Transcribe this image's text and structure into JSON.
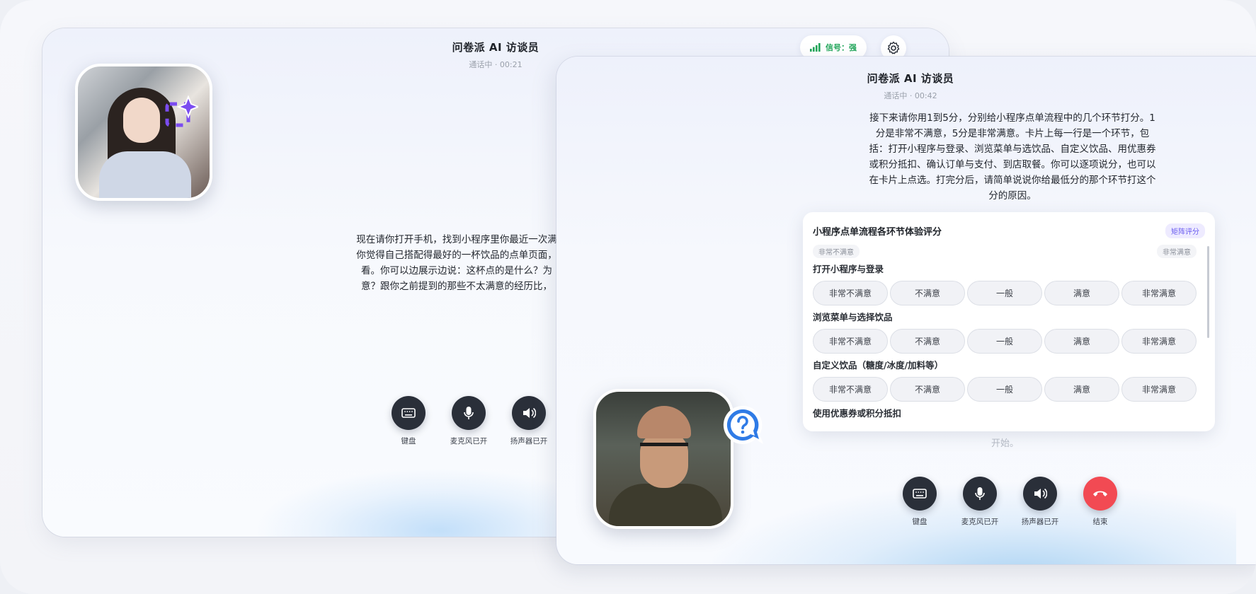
{
  "back_window": {
    "title": "问卷派 AI 访谈员",
    "subtitle": "通话中 · 00:21",
    "signal_label": "信号：强",
    "speech_lines": [
      "现在请你打开手机，找到小程序里你最近一次满",
      "你觉得自己搭配得最好的一杯饮品的点单页面，",
      "看。你可以边展示边说：这杯点的是什么？为",
      "意？跟你之前提到的那些不太满意的经历比，"
    ],
    "controls": [
      {
        "label": "键盘",
        "icon": "keyboard-icon"
      },
      {
        "label": "麦克风已开",
        "icon": "microphone-icon"
      },
      {
        "label": "扬声器已开",
        "icon": "speaker-icon"
      }
    ]
  },
  "front_window": {
    "title": "问卷派 AI 访谈员",
    "subtitle": "通话中 · 00:42",
    "question_lines": [
      "接下来请你用1到5分，分别给小程序点单流程中的几个环节打分。1",
      "分是非常不满意，5分是非常满意。卡片上每一行是一个环节，包",
      "括：打开小程序与登录、浏览菜单与选饮品、自定义饮品、用优惠券",
      "或积分抵扣、确认订单与支付、到店取餐。你可以逐项说分，也可以",
      "在卡片上点选。打完分后，请简单说说你给最低分的那个环节打这个",
      "分的原因。"
    ],
    "faded_text": "开始。",
    "card": {
      "title": "小程序点单流程各环节体验评分",
      "tag": "矩阵评分",
      "scale_low": "非常不满意",
      "scale_high": "非常满意",
      "items": [
        {
          "label": "打开小程序与登录",
          "options": [
            "非常不满意",
            "不满意",
            "一般",
            "满意",
            "非常满意"
          ]
        },
        {
          "label": "浏览菜单与选择饮品",
          "options": [
            "非常不满意",
            "不满意",
            "一般",
            "满意",
            "非常满意"
          ]
        },
        {
          "label": "自定义饮品（糖度/冰度/加料等）",
          "options": [
            "非常不满意",
            "不满意",
            "一般",
            "满意",
            "非常满意"
          ]
        },
        {
          "label": "使用优惠券或积分抵扣",
          "options": []
        }
      ]
    },
    "controls": [
      {
        "label": "键盘",
        "icon": "keyboard-icon"
      },
      {
        "label": "麦克风已开",
        "icon": "microphone-icon"
      },
      {
        "label": "扬声器已开",
        "icon": "speaker-icon"
      },
      {
        "label": "结束",
        "icon": "hang-up-icon"
      }
    ]
  },
  "colors": {
    "signal_green": "#22a65a",
    "end_call_red": "#f24a53",
    "control_dark": "#2a2f39",
    "tag_purple": "#6a5cf0",
    "badge_blue": "#2f7be6",
    "sparkle_purple": "#7b4cf0"
  }
}
